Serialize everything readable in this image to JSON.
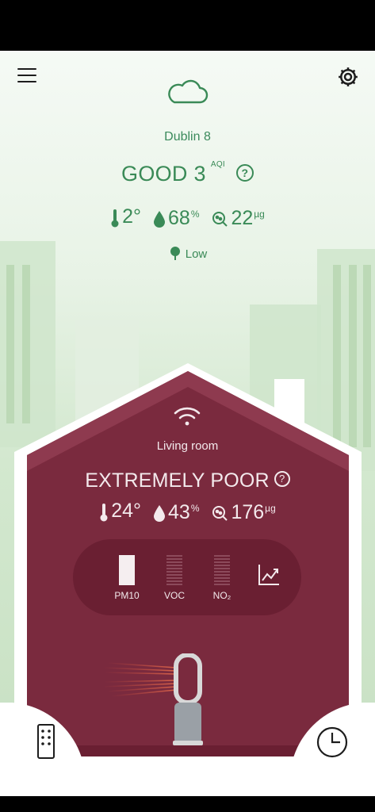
{
  "outdoor": {
    "location": "Dublin 8",
    "quality": "GOOD 3",
    "aqi_label": "AQI",
    "help_symbol": "?",
    "temperature": "2°",
    "humidity": "68",
    "humidity_unit": "%",
    "particulates": "22",
    "particulates_unit": "µg",
    "pollen": "Low"
  },
  "indoor": {
    "room": "Living room",
    "quality": "EXTREMELY POOR",
    "help_symbol": "?",
    "temperature": "24°",
    "humidity": "43",
    "humidity_unit": "%",
    "particulates": "176",
    "particulates_unit": "µg",
    "pollutants": [
      {
        "label": "PM10",
        "level": 1.0
      },
      {
        "label": "VOC",
        "level": 0.0
      },
      {
        "label": "NO₂",
        "level": 0.0
      }
    ]
  },
  "colors": {
    "outdoor_green": "#3a8a57",
    "house_maroon": "#7a2a3e",
    "panel": "#6a1f32",
    "text_light": "#f3e9ec"
  },
  "icons": {
    "menu": "hamburger-menu-icon",
    "settings": "gear-icon",
    "weather": "cloud-icon",
    "wifi": "wifi-icon",
    "chart": "line-chart-icon",
    "remote": "remote-control-icon",
    "schedule": "clock-icon"
  }
}
